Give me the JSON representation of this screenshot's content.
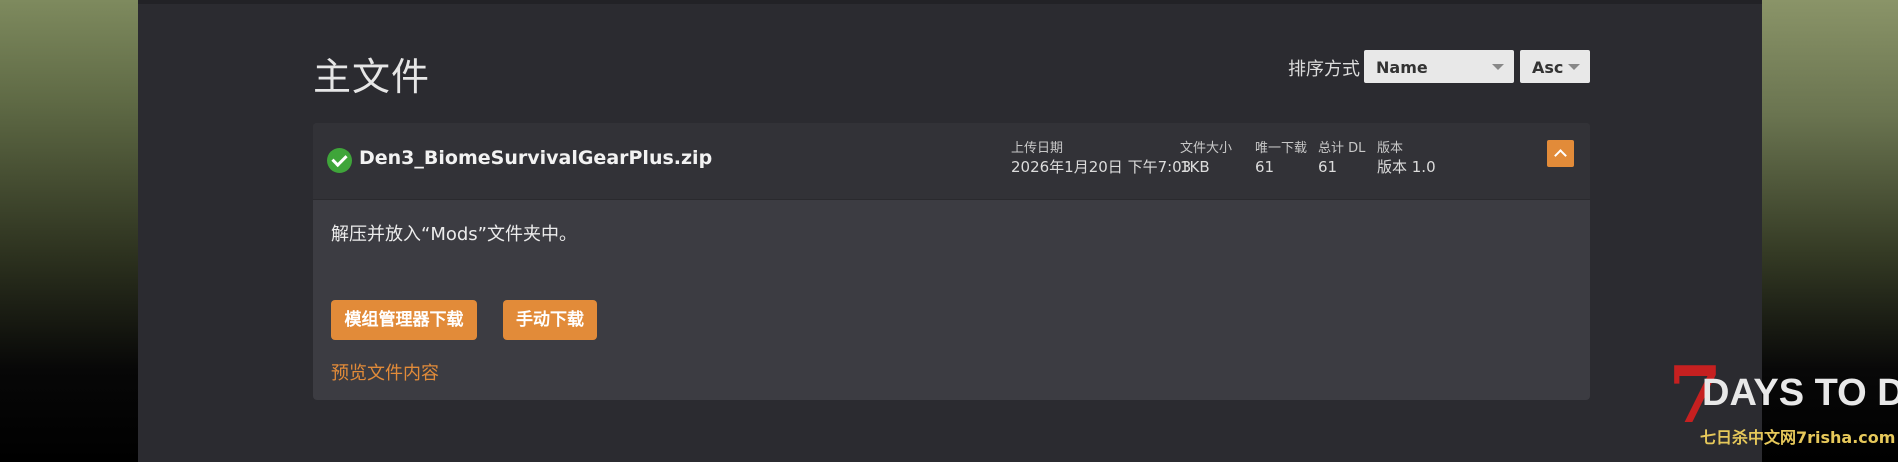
{
  "section": {
    "title": "主文件"
  },
  "sort": {
    "label": "排序方式",
    "field": "Name",
    "order": "Asc"
  },
  "file": {
    "name": "Den3_BiomeSurvivalGearPlus.zip",
    "upload_date_label": "上传日期",
    "upload_date": "2026年1月20日 下午7:03",
    "size_label": "文件大小",
    "size": "1KB",
    "unique_dl_label": "唯一下载",
    "unique_dl": "61",
    "total_dl_label": "总计 DL",
    "total_dl": "61",
    "version_label": "版本",
    "version": "版本 1.0",
    "description": "解压并放入“Mods”文件夹中。",
    "mod_manager_button": "模组管理器下载",
    "manual_button": "手动下载",
    "preview_link": "预览文件内容"
  },
  "watermark": {
    "logo_7": "7",
    "logo_text": "DAYS TO DIE",
    "site": "七日杀中文网7risha.com"
  },
  "colors": {
    "accent": "#e28b39",
    "success": "#3fa53a",
    "panel": "#2b2b30",
    "card": "#3c3c42"
  },
  "icons": {
    "status": "check-circle-icon",
    "collapse": "chevron-up-icon",
    "dropdown": "caret-down-icon"
  }
}
